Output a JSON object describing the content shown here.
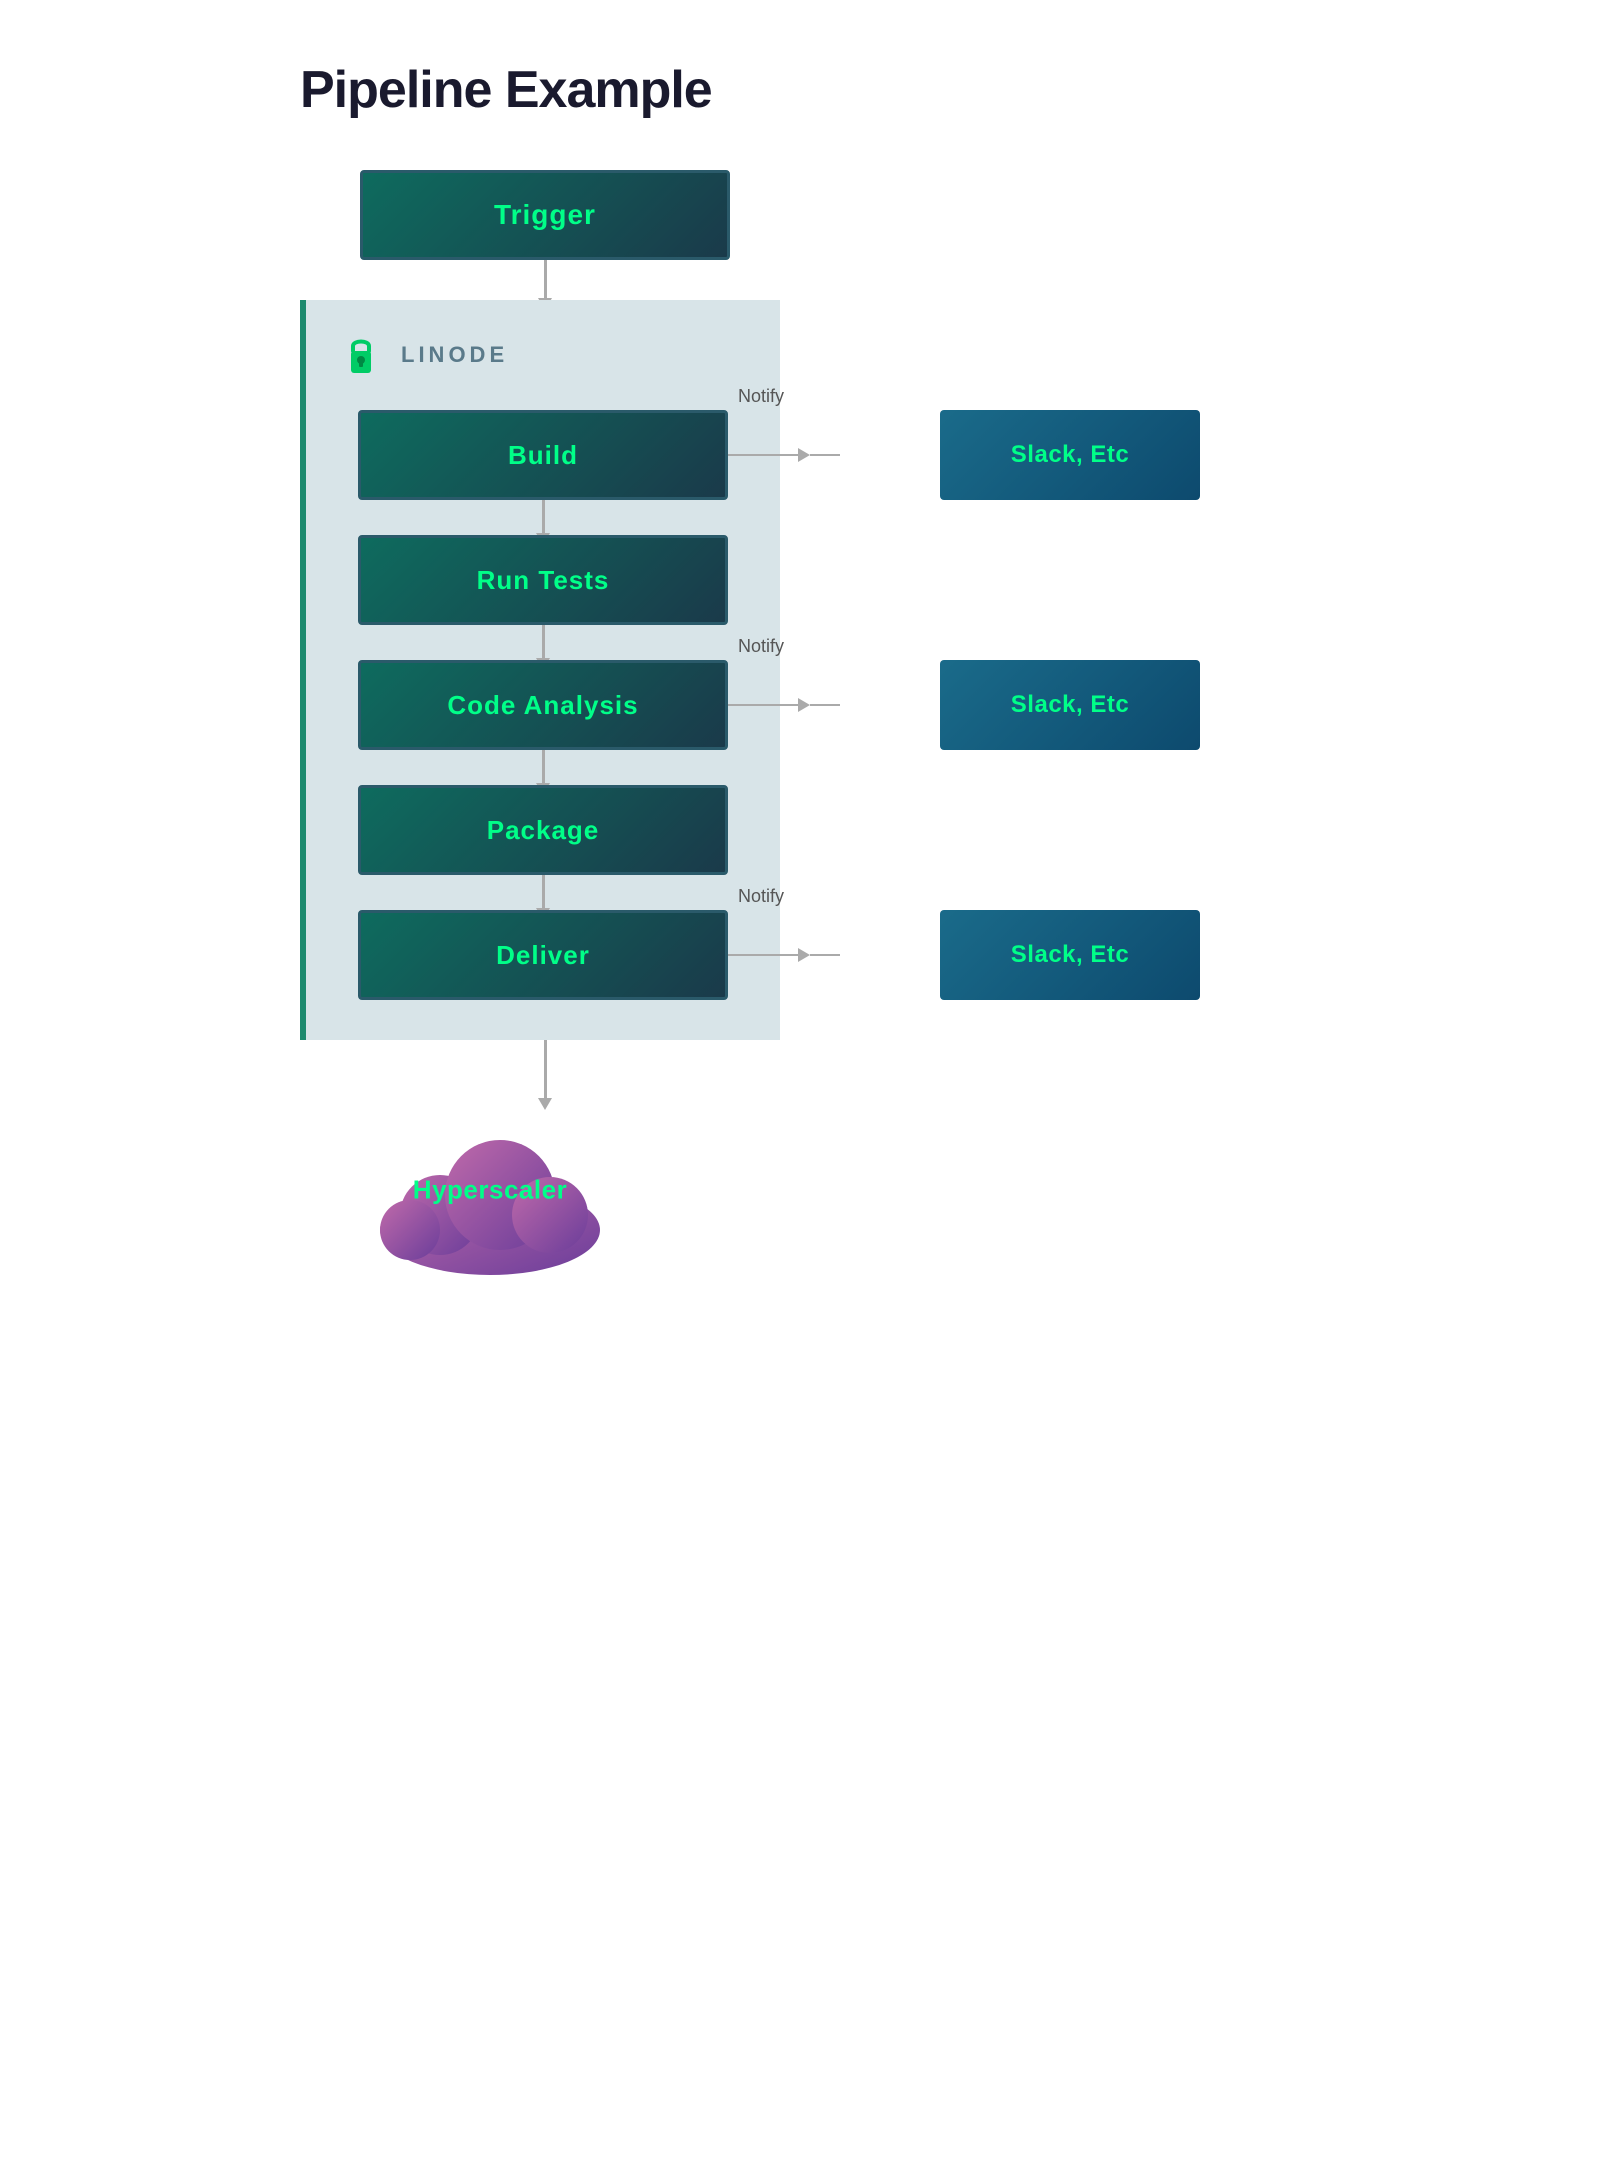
{
  "page": {
    "title": "Pipeline Example"
  },
  "trigger": {
    "label": "Trigger"
  },
  "linode": {
    "label": "LINODE"
  },
  "steps": [
    {
      "id": "build",
      "label": "Build",
      "hasNotify": true
    },
    {
      "id": "run-tests",
      "label": "Run Tests",
      "hasNotify": false
    },
    {
      "id": "code-analysis",
      "label": "Code Analysis",
      "hasNotify": true
    },
    {
      "id": "package",
      "label": "Package",
      "hasNotify": false
    },
    {
      "id": "deliver",
      "label": "Deliver",
      "hasNotify": true
    }
  ],
  "notify": {
    "label": "Notify"
  },
  "slack": {
    "label": "Slack, Etc"
  },
  "cloud": {
    "label": "Hyperscaler"
  },
  "colors": {
    "accent_green": "#00ff88",
    "step_bg_start": "#0e6b5e",
    "step_bg_end": "#1a3a4a",
    "linode_bg": "#d8e4e8",
    "slack_bg_start": "#1a6b8a",
    "slack_bg_end": "#0d4a6e",
    "cloud_purple_start": "#9b59b6",
    "cloud_purple_end": "#6a3d9a",
    "connector_color": "#aaaaaa"
  }
}
